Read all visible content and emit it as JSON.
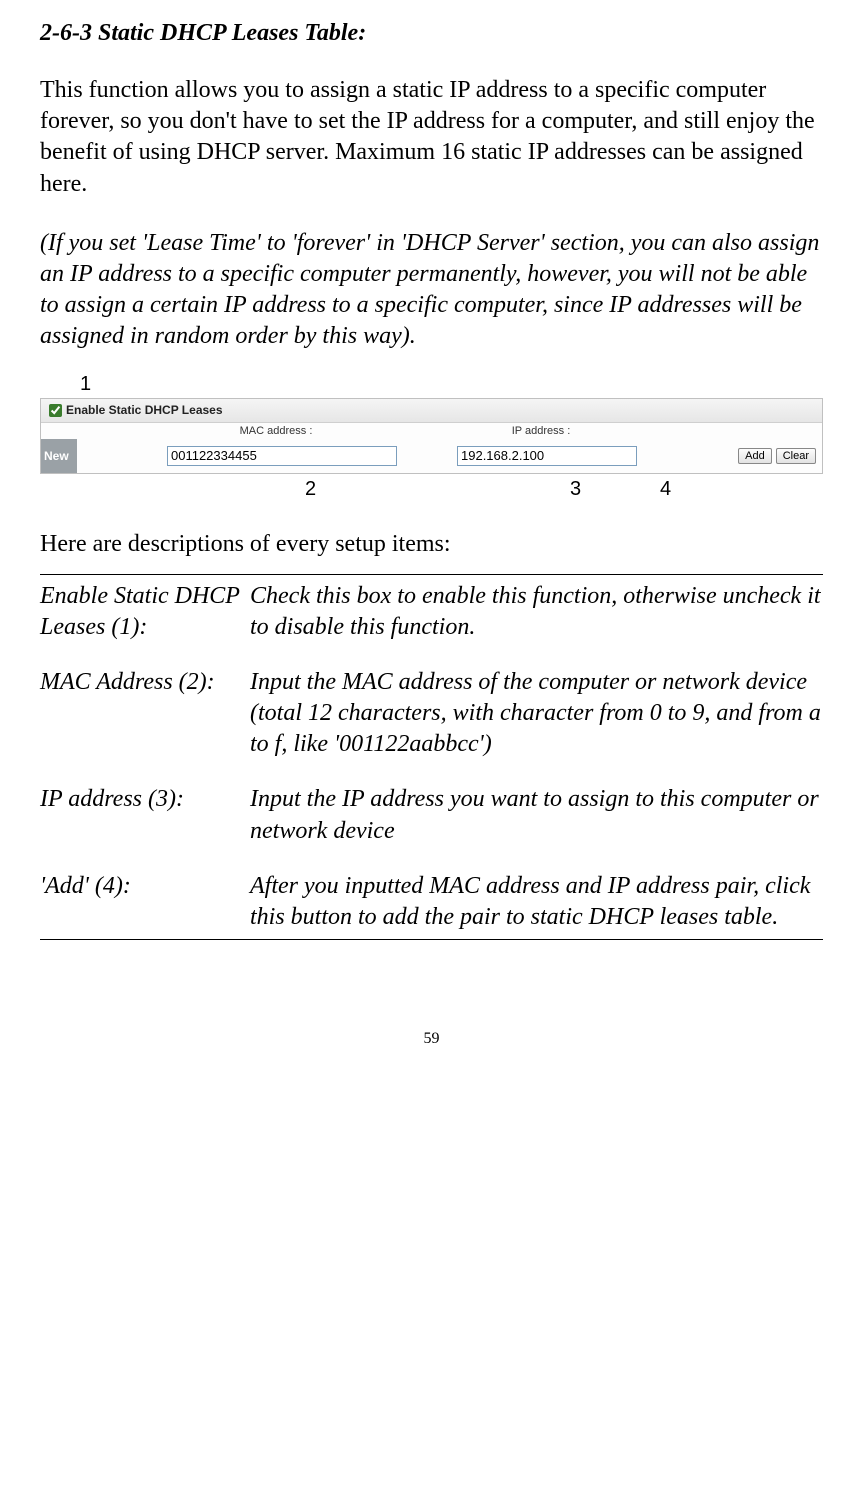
{
  "heading": "2-6-3 Static DHCP Leases Table:",
  "intro_para": "This function allows you to assign a static IP address to a specific computer forever, so you don't have to set the IP address for a computer, and still enjoy the benefit of using DHCP server. Maximum 16 static IP addresses can be assigned here.",
  "italic_para": "(If you set 'Lease Time' to 'forever' in 'DHCP Server' section, you can also assign an IP address to a specific computer permanently, however, you will not be able to assign a certain IP address to a specific computer, since IP addresses will be assigned in random order by this way).",
  "callouts": {
    "c1": "1",
    "c2": "2",
    "c3": "3",
    "c4": "4"
  },
  "ui": {
    "title": "Enable Static DHCP Leases",
    "new_label": "New",
    "mac_header": "MAC address :",
    "ip_header": "IP address :",
    "mac_value": "001122334455",
    "ip_value": "192.168.2.100",
    "add_btn": "Add",
    "clear_btn": "Clear"
  },
  "desc_intro": "Here are descriptions of every setup items:",
  "items": [
    {
      "label": "Enable Static DHCP Leases (1):",
      "text": "Check this box to enable this function, otherwise uncheck it to disable this function."
    },
    {
      "label": "MAC Address (2):",
      "text": "Input the MAC address of the computer or network device (total 12 characters, with character from 0 to 9, and from a to f, like '001122aabbcc')"
    },
    {
      "label": "IP address (3):",
      "text": "Input the IP address you want to assign to this computer or network device"
    },
    {
      "label": "'Add' (4):",
      "text": "After you inputted MAC address and IP address pair, click this button to add the pair to static DHCP leases table."
    }
  ],
  "page_number": "59"
}
